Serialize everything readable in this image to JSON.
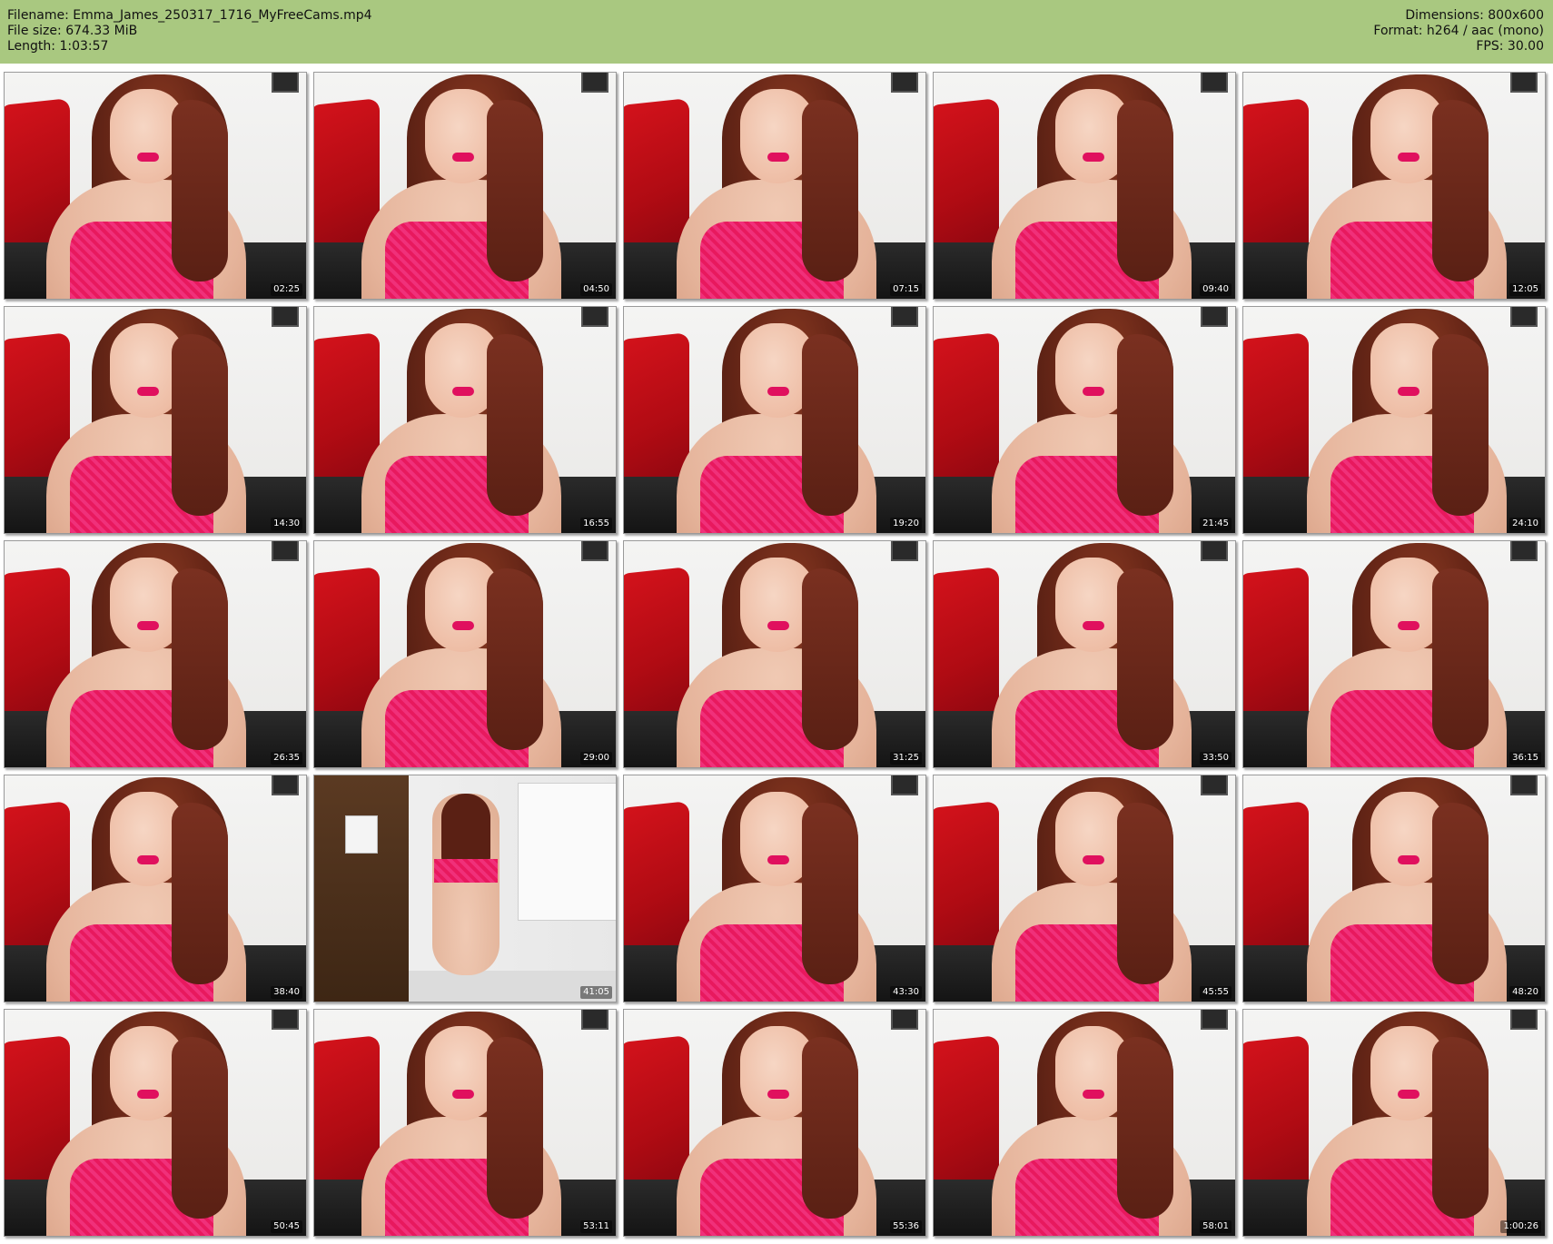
{
  "header": {
    "filename_line": "Filename: Emma_James_250317_1716_MyFreeCams.mp4",
    "filesize_line": "File size: 674.33 MiB",
    "length_line": "Length: 1:03:57",
    "dimensions_line": "Dimensions: 800x600",
    "format_line": "Format: h264 / aac (mono)",
    "fps_line": "FPS: 30.00"
  },
  "colors": {
    "header_background": "#a9c880",
    "page_background": "#ffffff"
  },
  "thumbnails": [
    {
      "timestamp": "02:25"
    },
    {
      "timestamp": "04:50"
    },
    {
      "timestamp": "07:15"
    },
    {
      "timestamp": "09:40"
    },
    {
      "timestamp": "12:05"
    },
    {
      "timestamp": "14:30"
    },
    {
      "timestamp": "16:55"
    },
    {
      "timestamp": "19:20"
    },
    {
      "timestamp": "21:45"
    },
    {
      "timestamp": "24:10"
    },
    {
      "timestamp": "26:35"
    },
    {
      "timestamp": "29:00"
    },
    {
      "timestamp": "31:25"
    },
    {
      "timestamp": "33:50"
    },
    {
      "timestamp": "36:15"
    },
    {
      "timestamp": "38:40"
    },
    {
      "timestamp": "41:05"
    },
    {
      "timestamp": "43:30"
    },
    {
      "timestamp": "45:55"
    },
    {
      "timestamp": "48:20"
    },
    {
      "timestamp": "50:45"
    },
    {
      "timestamp": "53:11"
    },
    {
      "timestamp": "55:36"
    },
    {
      "timestamp": "58:01"
    },
    {
      "timestamp": "1:00:26"
    }
  ]
}
